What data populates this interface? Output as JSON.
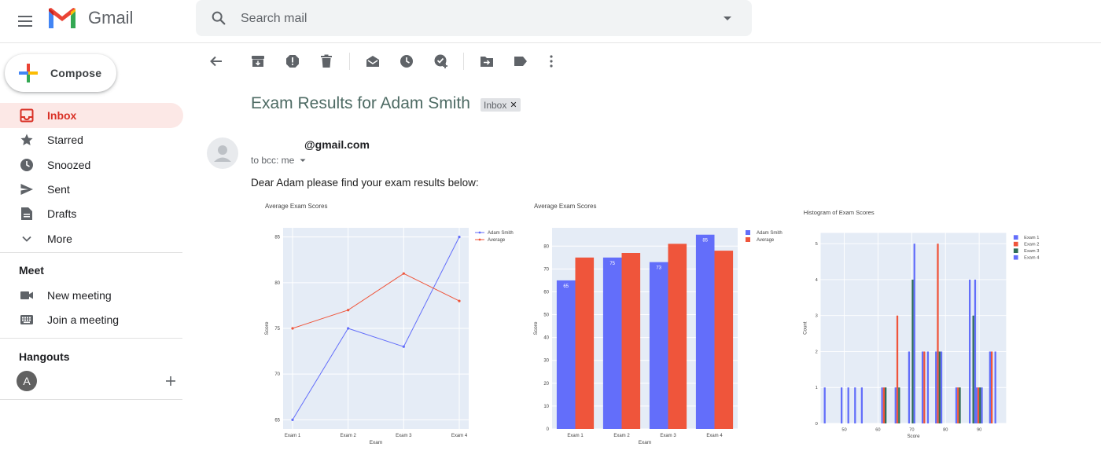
{
  "header": {
    "app_name": "Gmail",
    "search_placeholder": "Search mail"
  },
  "sidebar": {
    "compose_label": "Compose",
    "items": [
      {
        "label": "Inbox",
        "icon": "inbox-icon",
        "active": true
      },
      {
        "label": "Starred",
        "icon": "star-icon"
      },
      {
        "label": "Snoozed",
        "icon": "clock-icon"
      },
      {
        "label": "Sent",
        "icon": "send-icon"
      },
      {
        "label": "Drafts",
        "icon": "draft-icon"
      },
      {
        "label": "More",
        "icon": "chevron-down-icon"
      }
    ],
    "meet": {
      "title": "Meet",
      "items": [
        {
          "label": "New meeting",
          "icon": "video-icon"
        },
        {
          "label": "Join a meeting",
          "icon": "keyboard-icon"
        }
      ]
    },
    "hangouts": {
      "title": "Hangouts",
      "avatar_letter": "A"
    }
  },
  "toolbar": {
    "icons": [
      "back-arrow-icon",
      "archive-icon",
      "report-spam-icon",
      "delete-icon",
      "mark-unread-icon",
      "snooze-icon",
      "add-task-icon",
      "move-to-icon",
      "label-icon",
      "more-vert-icon"
    ]
  },
  "message": {
    "subject": "Exam Results for Adam Smith",
    "label_chip": "Inbox",
    "sender": "@gmail.com",
    "recipients": "to bcc: me",
    "body": "Dear Adam please find your exam results below:"
  },
  "colors": {
    "blue": "#636efa",
    "red": "#ef553b",
    "green": "#2e6d55",
    "plot_bg": "#e5ecf6",
    "active_nav": "#fce8e6",
    "active_text": "#d93025"
  },
  "chart_data": [
    {
      "type": "line",
      "title": "Average Exam Scores",
      "xlabel": "Exam",
      "ylabel": "Score",
      "categories": [
        "Exam 1",
        "Exam 2",
        "Exam 3",
        "Exam 4"
      ],
      "ylim": [
        64,
        86
      ],
      "yticks": [
        65,
        70,
        75,
        80,
        85
      ],
      "legend": "top-right",
      "series": [
        {
          "name": "Adam Smith",
          "values": [
            65,
            75,
            73,
            85
          ],
          "color": "#636efa"
        },
        {
          "name": "Average",
          "values": [
            75,
            77,
            81,
            78
          ],
          "color": "#ef553b"
        }
      ]
    },
    {
      "type": "bar",
      "title": "Average Exam Scores",
      "xlabel": "Exam",
      "ylabel": "Score",
      "categories": [
        "Exam 1",
        "Exam 2",
        "Exam 3",
        "Exam 4"
      ],
      "ylim": [
        0,
        88
      ],
      "yticks": [
        0,
        10,
        20,
        30,
        40,
        50,
        60,
        70,
        80
      ],
      "legend": "top-right",
      "series": [
        {
          "name": "Adam Smith",
          "values": [
            65,
            75,
            73,
            85
          ],
          "color": "#636efa",
          "labels": [
            "65",
            "75",
            "73",
            "85"
          ]
        },
        {
          "name": "Average",
          "values": [
            75,
            77,
            81,
            78
          ],
          "color": "#ef553b"
        }
      ]
    },
    {
      "type": "bar",
      "title": "Histogram of Exam Scores",
      "xlabel": "Score",
      "ylabel": "Count",
      "xlim": [
        43,
        98
      ],
      "xticks": [
        50,
        60,
        70,
        80,
        90
      ],
      "ylim": [
        0,
        5.3
      ],
      "yticks": [
        0,
        1,
        2,
        3,
        4,
        5
      ],
      "legend": "top-right",
      "bins": [
        45,
        50,
        52,
        54,
        56,
        58,
        60,
        62,
        64,
        66,
        68,
        70,
        72,
        74,
        76,
        78,
        80,
        82,
        84,
        86,
        88,
        90,
        92,
        94,
        96
      ],
      "series": [
        {
          "name": "Exam 1",
          "color": "#636efa",
          "values": [
            1,
            1,
            1,
            1,
            1,
            0,
            0,
            1,
            0,
            1,
            0,
            2,
            0,
            2,
            0,
            2,
            0,
            0,
            1,
            0,
            4,
            1,
            0,
            2,
            0
          ]
        },
        {
          "name": "Exam 2",
          "color": "#ef553b",
          "values": [
            0,
            0,
            0,
            0,
            0,
            0,
            0,
            1,
            0,
            3,
            0,
            0,
            0,
            2,
            0,
            5,
            0,
            0,
            1,
            0,
            0,
            1,
            0,
            2,
            0
          ]
        },
        {
          "name": "Exam 3",
          "color": "#2e6d55",
          "values": [
            0,
            0,
            0,
            0,
            0,
            0,
            0,
            1,
            0,
            1,
            0,
            4,
            0,
            0,
            0,
            2,
            0,
            0,
            1,
            0,
            3,
            1,
            0,
            0,
            0
          ]
        },
        {
          "name": "Exam 4",
          "color": "#636efa",
          "values": [
            0,
            0,
            0,
            0,
            0,
            0,
            0,
            0,
            0,
            0,
            0,
            5,
            0,
            2,
            0,
            2,
            0,
            0,
            0,
            0,
            4,
            1,
            0,
            2,
            0
          ]
        }
      ]
    }
  ]
}
